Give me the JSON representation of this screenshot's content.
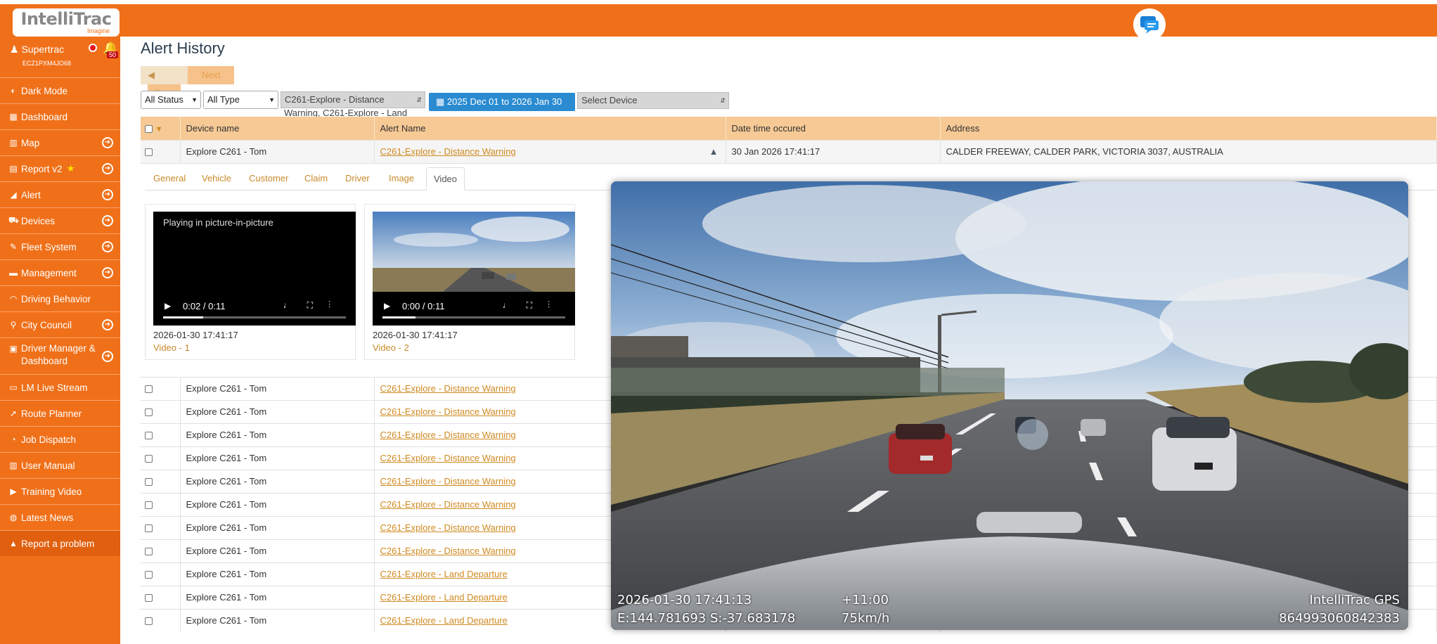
{
  "brand": {
    "name": "IntelliTrac",
    "tagline": "Imagine"
  },
  "user": {
    "name": "Supertrac",
    "account": "ECZ1PXM4JO68",
    "notifications": "50"
  },
  "nav": [
    {
      "label": "Dark Mode",
      "icon": "moon-icon",
      "glyph": "◐",
      "arrow": false
    },
    {
      "label": "Dashboard",
      "icon": "grid-icon",
      "glyph": "▦",
      "arrow": false
    },
    {
      "label": "Map",
      "icon": "map-icon",
      "glyph": "▥",
      "arrow": true
    },
    {
      "label": "Report v2",
      "icon": "report-icon",
      "glyph": "▤",
      "arrow": true,
      "star": true
    },
    {
      "label": "Alert",
      "icon": "megaphone-icon",
      "glyph": "◢",
      "arrow": true
    },
    {
      "label": "Devices",
      "icon": "car-icon",
      "glyph": "⛟",
      "arrow": true
    },
    {
      "label": "Fleet System",
      "icon": "wrench-icon",
      "glyph": "✎",
      "arrow": true
    },
    {
      "label": "Management",
      "icon": "briefcase-icon",
      "glyph": "▬",
      "arrow": true
    },
    {
      "label": "Driving Behavior",
      "icon": "gauge-icon",
      "glyph": "◠",
      "arrow": false
    },
    {
      "label": "City Council",
      "icon": "pin-icon",
      "glyph": "⚲",
      "arrow": true
    },
    {
      "label": "Driver Manager & Dashboard",
      "icon": "id-card-icon",
      "glyph": "▣",
      "arrow": true,
      "tall": true
    },
    {
      "label": "LM Live Stream",
      "icon": "monitor-icon",
      "glyph": "▭",
      "arrow": false
    },
    {
      "label": "Route Planner",
      "icon": "send-icon",
      "glyph": "➚",
      "arrow": false
    },
    {
      "label": "Job Dispatch",
      "icon": "speed-icon",
      "glyph": "◔",
      "arrow": false
    },
    {
      "label": "User Manual",
      "icon": "book-icon",
      "glyph": "▥",
      "arrow": false
    },
    {
      "label": "Training Video",
      "icon": "youtube-icon",
      "glyph": "▶",
      "arrow": false
    },
    {
      "label": "Latest News",
      "icon": "rss-icon",
      "glyph": "◍",
      "arrow": false
    },
    {
      "label": "Report a problem",
      "icon": "warning-icon",
      "glyph": "▲",
      "arrow": false
    }
  ],
  "page": {
    "title": "Alert History",
    "prev": "Prev",
    "next": "Next"
  },
  "filters": {
    "status": "All Status",
    "type": "All Type",
    "alert": "C261-Explore - Distance",
    "alert_overflow": "Warning, C261-Explore - Land Departure",
    "date_range": "2025 Dec 01 to 2026 Jan 30",
    "device_placeholder": "Select Device"
  },
  "table": {
    "headers": [
      "Device name",
      "Alert Name",
      "Date time occured",
      "Address"
    ],
    "first_row": {
      "device": "Explore C261 - Tom",
      "alert": "C261-Explore - Distance Warning",
      "datetime": "30 Jan 2026 17:41:17",
      "address": "CALDER FREEWAY, CALDER PARK, VICTORIA 3037, AUSTRALIA"
    },
    "rows": [
      {
        "device": "Explore C261 - Tom",
        "alert": "C261-Explore - Distance Warning"
      },
      {
        "device": "Explore C261 - Tom",
        "alert": "C261-Explore - Distance Warning"
      },
      {
        "device": "Explore C261 - Tom",
        "alert": "C261-Explore - Distance Warning"
      },
      {
        "device": "Explore C261 - Tom",
        "alert": "C261-Explore - Distance Warning"
      },
      {
        "device": "Explore C261 - Tom",
        "alert": "C261-Explore - Distance Warning"
      },
      {
        "device": "Explore C261 - Tom",
        "alert": "C261-Explore - Distance Warning"
      },
      {
        "device": "Explore C261 - Tom",
        "alert": "C261-Explore - Distance Warning"
      },
      {
        "device": "Explore C261 - Tom",
        "alert": "C261-Explore - Distance Warning"
      },
      {
        "device": "Explore C261 - Tom",
        "alert": "C261-Explore - Land Departure"
      },
      {
        "device": "Explore C261 - Tom",
        "alert": "C261-Explore - Land Departure"
      },
      {
        "device": "Explore C261 - Tom",
        "alert": "C261-Explore - Land Departure"
      }
    ]
  },
  "detail_tabs": [
    "General",
    "Vehicle",
    "Customer",
    "Claim",
    "Driver",
    "Image",
    "Video"
  ],
  "videos": [
    {
      "label": "Video - 1",
      "timestamp": "2026-01-30 17:41:17",
      "time": "0:02 / 0:11",
      "progress": 0.22,
      "status": "Playing in picture-in-picture"
    },
    {
      "label": "Video - 2",
      "timestamp": "2026-01-30 17:41:17",
      "time": "0:00 / 0:11",
      "progress": 0.18,
      "status": ""
    }
  ],
  "pip_overlay": {
    "datetime": "2026-01-30  17:41:13",
    "coords": "E:144.781693  S:-37.683178",
    "tz": "+11:00",
    "speed": "75km/h",
    "brand": "IntelliTrac GPS",
    "device_id": "864993060842383"
  },
  "colors": {
    "accent": "#f07019",
    "header": "#f6c995",
    "link": "#d08a21",
    "date_button": "#2a8bd1"
  }
}
